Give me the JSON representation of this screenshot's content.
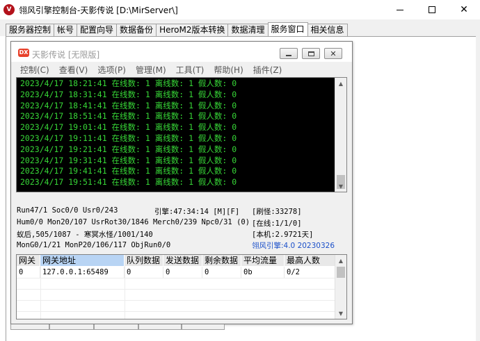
{
  "app": {
    "logo_text": "V",
    "title": "翎风引擎控制台-天影传说 [D:\\MirServer\\]"
  },
  "tabs": [
    {
      "label": "服务器控制",
      "active": false
    },
    {
      "label": "帐号",
      "active": false
    },
    {
      "label": "配置向导",
      "active": false
    },
    {
      "label": "数据备份",
      "active": false
    },
    {
      "label": "HeroM2版本转换",
      "active": false
    },
    {
      "label": "数据清理",
      "active": false
    },
    {
      "label": "服务窗口",
      "active": true
    },
    {
      "label": "相关信息",
      "active": false
    }
  ],
  "inner_window": {
    "logo_text": "DX",
    "title": "天影传说 [无限版]",
    "menu": [
      "控制(C)",
      "查看(V)",
      "选项(P)",
      "管理(M)",
      "工具(T)",
      "帮助(H)",
      "插件(Z)"
    ]
  },
  "log_lines": [
    "2023/4/17 18:21:41 在线数: 1 离线数: 1 假人数: 0",
    "2023/4/17 18:31:41 在线数: 1 离线数: 1 假人数: 0",
    "2023/4/17 18:41:41 在线数: 1 离线数: 1 假人数: 0",
    "2023/4/17 18:51:41 在线数: 1 离线数: 1 假人数: 0",
    "2023/4/17 19:01:41 在线数: 1 离线数: 1 假人数: 0",
    "2023/4/17 19:11:41 在线数: 1 离线数: 1 假人数: 0",
    "2023/4/17 19:21:41 在线数: 1 离线数: 1 假人数: 0",
    "2023/4/17 19:31:41 在线数: 1 离线数: 1 假人数: 0",
    "2023/4/17 19:41:41 在线数: 1 离线数: 1 假人数: 0",
    "2023/4/17 19:51:41 在线数: 1 离线数: 1 假人数: 0"
  ],
  "status": {
    "line1_left": "Run47/1 Soc0/0 Usr0/243",
    "line1_mid": "引擎:47:34:14 [M][F]",
    "line1_right": "[刷怪:33278]",
    "line2_left": "Hum0/0 Mon20/107 UsrRot30/1846 Merch0/239 Npc0/31 (0)",
    "line2_right": "[在线:1/1/0]",
    "line3_left": "蚁后,505/1087 - 寒冥水怪/1001/140",
    "line3_right": "[本机:2.9721天]",
    "line4_left": "MonG0/1/21 MonP20/106/117 ObjRun0/0",
    "line4_right": "翎风引擎:4.0 20230326"
  },
  "gateway": {
    "headers": [
      "网关",
      "网关地址",
      "队列数据",
      "发送数据",
      "剩余数据",
      "平均流量",
      "最高人数"
    ],
    "rows": [
      [
        "0",
        "127.0.0.1:65489",
        "0",
        "0",
        "0",
        "0b",
        "0/2"
      ]
    ]
  },
  "colors": {
    "log_text": "#37d737",
    "log_bg": "#000000",
    "version_text": "#1a4fc9",
    "header_highlight": "#b8d4f4"
  }
}
